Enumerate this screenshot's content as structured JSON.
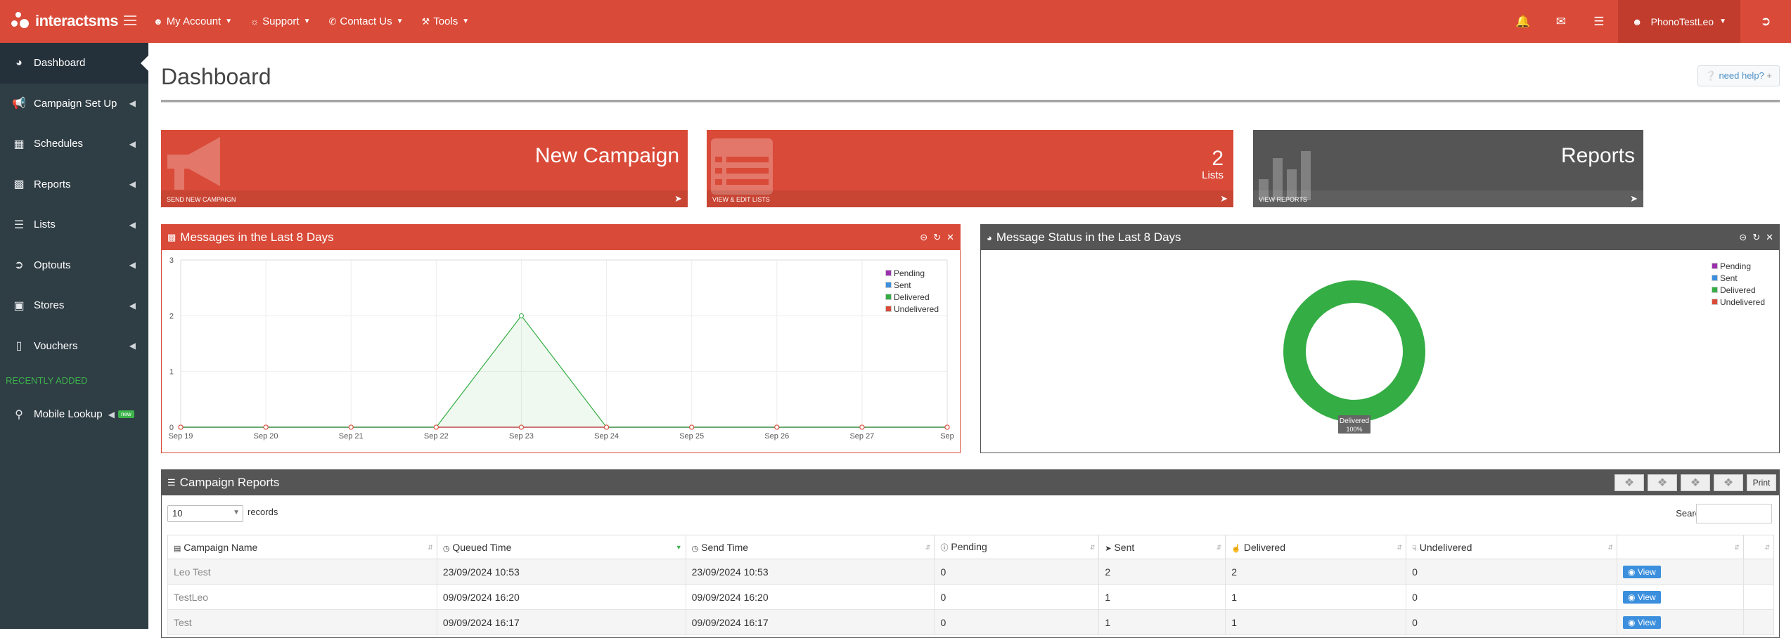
{
  "brand": {
    "name": "interactsms"
  },
  "topnav": {
    "my_account": "My Account",
    "support": "Support",
    "contact_us": "Contact Us",
    "tools": "Tools"
  },
  "user": {
    "name": "PhonoTestLeo"
  },
  "sidebar": {
    "items": [
      {
        "label": "Dashboard",
        "icon": "dashboard-icon"
      },
      {
        "label": "Campaign Set Up",
        "icon": "bullhorn-icon"
      },
      {
        "label": "Schedules",
        "icon": "calendar-icon"
      },
      {
        "label": "Reports",
        "icon": "bar-chart-icon"
      },
      {
        "label": "Lists",
        "icon": "list-icon"
      },
      {
        "label": "Optouts",
        "icon": "sign-out-icon"
      },
      {
        "label": "Stores",
        "icon": "store-icon"
      },
      {
        "label": "Vouchers",
        "icon": "barcode-icon"
      }
    ],
    "recent_heading": "RECENTLY ADDED",
    "mobile_lookup": {
      "label": "Mobile Lookup",
      "badge": "new"
    }
  },
  "page": {
    "title": "Dashboard",
    "need_help": "need help?"
  },
  "tiles": {
    "campaign": {
      "title": "New Campaign",
      "footer": "SEND NEW CAMPAIGN"
    },
    "lists": {
      "count": "2",
      "sub": "Lists",
      "footer": "VIEW & EDIT LISTS"
    },
    "reports": {
      "title": "Reports",
      "footer": "VIEW REPORTS"
    }
  },
  "messages_panel": {
    "title": "Messages in the Last 8 Days"
  },
  "status_panel": {
    "title": "Message Status in the Last 8 Days",
    "donut_label": "Delivered",
    "donut_percent": "100%"
  },
  "legend": [
    "Pending",
    "Sent",
    "Delivered",
    "Undelivered"
  ],
  "colors": {
    "pending": "#9b2fae",
    "sent": "#3b8fdd",
    "delivered": "#34ad44",
    "undelivered": "#d94a38",
    "brand_red": "#d94a38",
    "dark_grey": "#555555"
  },
  "chart_data": [
    {
      "type": "line",
      "title": "Messages in the Last 8 Days",
      "categories": [
        "Sep 19",
        "Sep 20",
        "Sep 21",
        "Sep 22",
        "Sep 23",
        "Sep 24",
        "Sep 25",
        "Sep 26",
        "Sep 27",
        "Sep"
      ],
      "yticks": [
        "0",
        "1",
        "2",
        "3"
      ],
      "ylim": [
        0,
        3
      ],
      "series": [
        {
          "name": "Pending",
          "values": [
            0,
            0,
            0,
            0,
            0,
            0,
            0,
            0,
            0,
            0
          ]
        },
        {
          "name": "Sent",
          "values": [
            0,
            0,
            0,
            0,
            0,
            0,
            0,
            0,
            0,
            0
          ]
        },
        {
          "name": "Delivered",
          "values": [
            0,
            0,
            0,
            0,
            2,
            0,
            0,
            0,
            0,
            0
          ]
        },
        {
          "name": "Undelivered",
          "values": [
            0,
            0,
            0,
            0,
            0,
            0,
            0,
            0,
            0,
            0
          ]
        }
      ],
      "grid": true,
      "legend": "top-right"
    },
    {
      "type": "pie",
      "title": "Message Status in the Last 8 Days",
      "slices": [
        {
          "name": "Pending",
          "value": 0
        },
        {
          "name": "Sent",
          "value": 0
        },
        {
          "name": "Delivered",
          "value": 100
        },
        {
          "name": "Undelivered",
          "value": 0
        }
      ],
      "legend": "top-right"
    }
  ],
  "reports_table": {
    "title": "Campaign Reports",
    "print_label": "Print",
    "length_value": "10",
    "length_label": "records",
    "search_label": "Search:",
    "columns": [
      "Campaign Name",
      "Queued Time",
      "Send Time",
      "Pending",
      "Sent",
      "Delivered",
      "Undelivered",
      ""
    ],
    "rows": [
      {
        "name": "Leo Test",
        "queued": "23/09/2024 10:53",
        "send": "23/09/2024 10:53",
        "pending": "0",
        "sent": "2",
        "delivered": "2",
        "undelivered": "0",
        "action": "View"
      },
      {
        "name": "TestLeo",
        "queued": "09/09/2024 16:20",
        "send": "09/09/2024 16:20",
        "pending": "0",
        "sent": "1",
        "delivered": "1",
        "undelivered": "0",
        "action": "View"
      },
      {
        "name": "Test",
        "queued": "09/09/2024 16:17",
        "send": "09/09/2024 16:17",
        "pending": "0",
        "sent": "1",
        "delivered": "1",
        "undelivered": "0",
        "action": "View"
      }
    ]
  }
}
